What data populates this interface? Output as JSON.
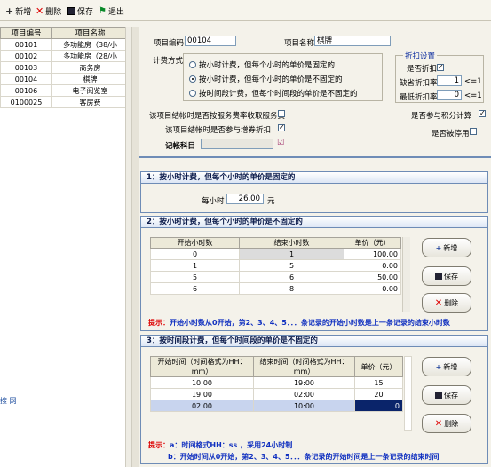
{
  "toolbar": {
    "add": "新增",
    "delete": "删除",
    "save": "保存",
    "exit": "退出"
  },
  "left": {
    "headers": [
      "项目编号",
      "项目名称"
    ],
    "rows": [
      [
        "00101",
        "多功能房（38/小"
      ],
      [
        "00102",
        "多功能房（28/小"
      ],
      [
        "00103",
        "商务房"
      ],
      [
        "00104",
        "棋牌"
      ],
      [
        "00106",
        "电子阅览室"
      ],
      [
        "0100025",
        "客房费"
      ]
    ],
    "side_text": "搜 网"
  },
  "form": {
    "code_label": "项目编码",
    "code_value": "00104",
    "name_label": "项目名称",
    "name_value": "棋牌",
    "billing_label": "计费方式",
    "options": [
      "按小时计费，但每个小时的单价是固定的",
      "按小时计费，但每个小时的单价是不固定的",
      "按时间段计费，但每个时间段的单价是不固定的"
    ],
    "selected": 1,
    "discount": {
      "title": "折扣设置",
      "allow_label": "是否折扣",
      "default_label": "缺省折扣率",
      "default_value": "1",
      "default_unit": "<=1",
      "min_label": "最低折扣率",
      "min_value": "0",
      "min_unit": "<=1"
    },
    "service_label": "该项目结帐时是否按服务费率收取服务费",
    "gift_label": "该项目结帐时是否参与增券折扣",
    "account_label": "记帐科目",
    "points_label": "是否参与积分计算",
    "disabled_label": "是否被停用"
  },
  "s1": {
    "title": "1：按小时计费，但每个小时的单价是固定的",
    "price_label": "每小时",
    "price_value": "26.00",
    "unit": "元"
  },
  "s2": {
    "title": "2：按小时计费，但每个小时的单价是不固定的",
    "headers": [
      "开始小时数",
      "结束小时数",
      "单价（元）"
    ],
    "rows": [
      [
        "0",
        "1",
        "100.00"
      ],
      [
        "1",
        "5",
        "0.00"
      ],
      [
        "5",
        "6",
        "50.00"
      ],
      [
        "6",
        "8",
        "0.00"
      ]
    ],
    "buttons": [
      "新增",
      "保存",
      "删除"
    ],
    "hint_prefix": "提示：",
    "hint": "开始小时数从0开始，第2、3、4、5．．．条记录的开始小时数是上一条记录的结束小时数"
  },
  "s3": {
    "title": "3：按时间段计费，但每个时间段的单价是不固定的",
    "headers": [
      "开始时间（时间格式为HH：mm）",
      "结束时间（时间格式为HH：mm）",
      "单价（元）"
    ],
    "rows": [
      [
        "10:00",
        "19:00",
        "15"
      ],
      [
        "19:00",
        "02:00",
        "20"
      ],
      [
        "02:00",
        "10:00",
        "0"
      ]
    ],
    "buttons": [
      "新增",
      "保存",
      "删除"
    ],
    "hint_prefix": "提示：",
    "hint_a": "a：时间格式HH：ss ，采用24小时制",
    "hint_b": "b：开始时间从0开始，第2、3、4、5．．．条记录的开始时间是上一条记录的结束时间"
  },
  "colors": {
    "accent": "#6e8cb6",
    "hint": "#1030c0",
    "hint_red": "#d00000",
    "selected_cell": "#0a246a"
  }
}
